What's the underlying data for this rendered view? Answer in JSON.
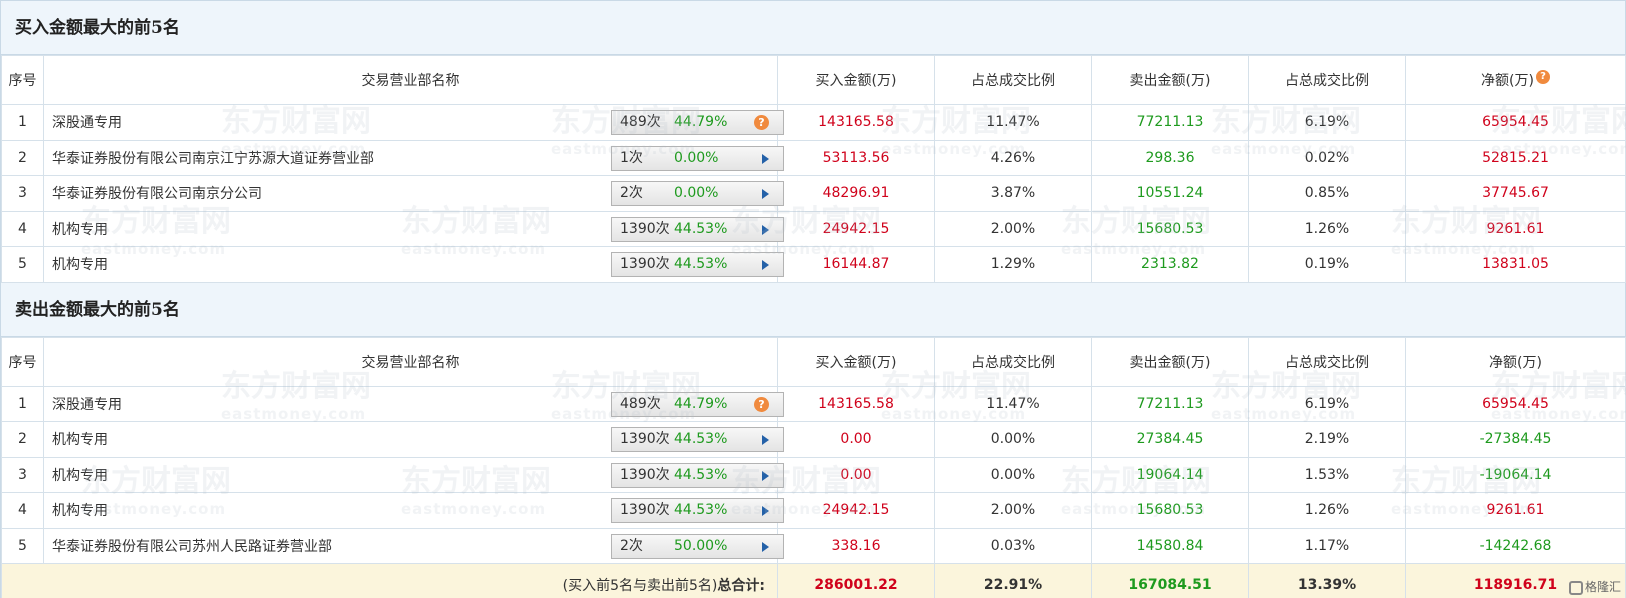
{
  "colors": {
    "red": "#d0021b",
    "green": "#1e9a1e",
    "header_bg": "#eef5fb",
    "total_bg": "#fbf5dc",
    "help_icon": "#f08a3e"
  },
  "watermark": {
    "text": "东方财富网",
    "sub": "eastmoney.com"
  },
  "columns": {
    "seq": "序号",
    "name": "交易营业部名称",
    "buy": "买入金额(万)",
    "buy_ratio": "占总成交比例",
    "sell": "卖出金额(万)",
    "sell_ratio": "占总成交比例",
    "net": "净额(万)"
  },
  "buy_section": {
    "title": "买入金额最大的前5名",
    "rows": [
      {
        "seq": "1",
        "name": "深股通专用",
        "count": "489次",
        "pct": "44.79%",
        "icon": "help-icon",
        "buy": "143165.58",
        "buy_ratio": "11.47%",
        "sell": "77211.13",
        "sell_ratio": "6.19%",
        "net": "65954.45"
      },
      {
        "seq": "2",
        "name": "华泰证券股份有限公司南京江宁苏源大道证券营业部",
        "count": "1次",
        "pct": "0.00%",
        "icon": "arrow-right-icon",
        "buy": "53113.56",
        "buy_ratio": "4.26%",
        "sell": "298.36",
        "sell_ratio": "0.02%",
        "net": "52815.21"
      },
      {
        "seq": "3",
        "name": "华泰证券股份有限公司南京分公司",
        "count": "2次",
        "pct": "0.00%",
        "icon": "arrow-right-icon",
        "buy": "48296.91",
        "buy_ratio": "3.87%",
        "sell": "10551.24",
        "sell_ratio": "0.85%",
        "net": "37745.67"
      },
      {
        "seq": "4",
        "name": "机构专用",
        "count": "1390次",
        "pct": "44.53%",
        "icon": "arrow-right-icon",
        "buy": "24942.15",
        "buy_ratio": "2.00%",
        "sell": "15680.53",
        "sell_ratio": "1.26%",
        "net": "9261.61"
      },
      {
        "seq": "5",
        "name": "机构专用",
        "count": "1390次",
        "pct": "44.53%",
        "icon": "arrow-right-icon",
        "buy": "16144.87",
        "buy_ratio": "1.29%",
        "sell": "2313.82",
        "sell_ratio": "0.19%",
        "net": "13831.05"
      }
    ]
  },
  "sell_section": {
    "title": "卖出金额最大的前5名",
    "rows": [
      {
        "seq": "1",
        "name": "深股通专用",
        "count": "489次",
        "pct": "44.79%",
        "icon": "help-icon",
        "buy": "143165.58",
        "buy_ratio": "11.47%",
        "sell": "77211.13",
        "sell_ratio": "6.19%",
        "net": "65954.45"
      },
      {
        "seq": "2",
        "name": "机构专用",
        "count": "1390次",
        "pct": "44.53%",
        "icon": "arrow-right-icon",
        "buy": "0.00",
        "buy_ratio": "0.00%",
        "sell": "27384.45",
        "sell_ratio": "2.19%",
        "net": "-27384.45"
      },
      {
        "seq": "3",
        "name": "机构专用",
        "count": "1390次",
        "pct": "44.53%",
        "icon": "arrow-right-icon",
        "buy": "0.00",
        "buy_ratio": "0.00%",
        "sell": "19064.14",
        "sell_ratio": "1.53%",
        "net": "-19064.14"
      },
      {
        "seq": "4",
        "name": "机构专用",
        "count": "1390次",
        "pct": "44.53%",
        "icon": "arrow-right-icon",
        "buy": "24942.15",
        "buy_ratio": "2.00%",
        "sell": "15680.53",
        "sell_ratio": "1.26%",
        "net": "9261.61"
      },
      {
        "seq": "5",
        "name": "华泰证券股份有限公司苏州人民路证券营业部",
        "count": "2次",
        "pct": "50.00%",
        "icon": "arrow-right-icon",
        "buy": "338.16",
        "buy_ratio": "0.03%",
        "sell": "14580.84",
        "sell_ratio": "1.17%",
        "net": "-14242.68"
      }
    ],
    "total": {
      "label_prefix": "(买入前5名与卖出前5名)",
      "label_bold": "总合计:",
      "buy": "286001.22",
      "buy_ratio": "22.91%",
      "sell": "167084.51",
      "sell_ratio": "13.39%",
      "net": "118916.71"
    }
  },
  "logo": {
    "text": "格隆汇"
  }
}
